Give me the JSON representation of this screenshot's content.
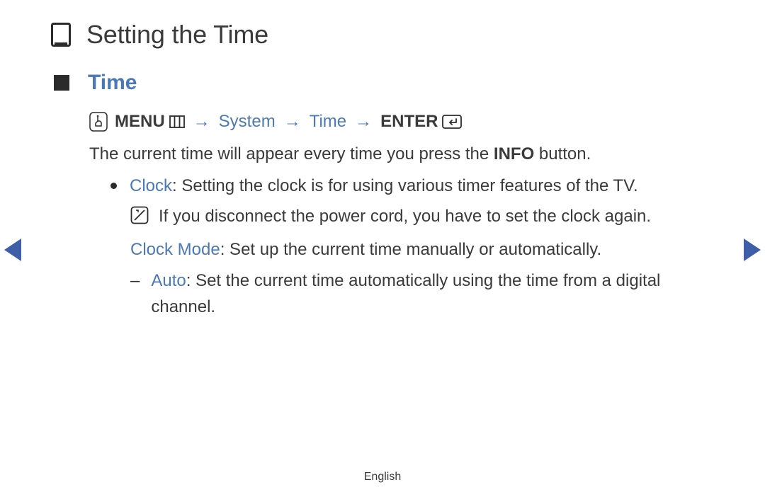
{
  "page": {
    "title": "Setting the Time",
    "section": "Time",
    "footer_language": "English"
  },
  "nav_path": {
    "menu_label": "MENU",
    "arrow": "→",
    "system_label": "System",
    "time_label": "Time",
    "enter_label": "ENTER"
  },
  "body": {
    "intro_prefix": "The current time will appear every time you press the ",
    "intro_bold": "INFO",
    "intro_suffix": " button.",
    "clock_term": "Clock",
    "clock_desc": ": Setting the clock is for using various timer features of the TV.",
    "note_text": "If you disconnect the power cord, you have to set the clock again.",
    "clock_mode_term": "Clock Mode",
    "clock_mode_desc": ": Set up the current time manually or automatically.",
    "dash": "–",
    "auto_term": "Auto",
    "auto_desc": ": Set the current time automatically using the time from a digital channel."
  }
}
